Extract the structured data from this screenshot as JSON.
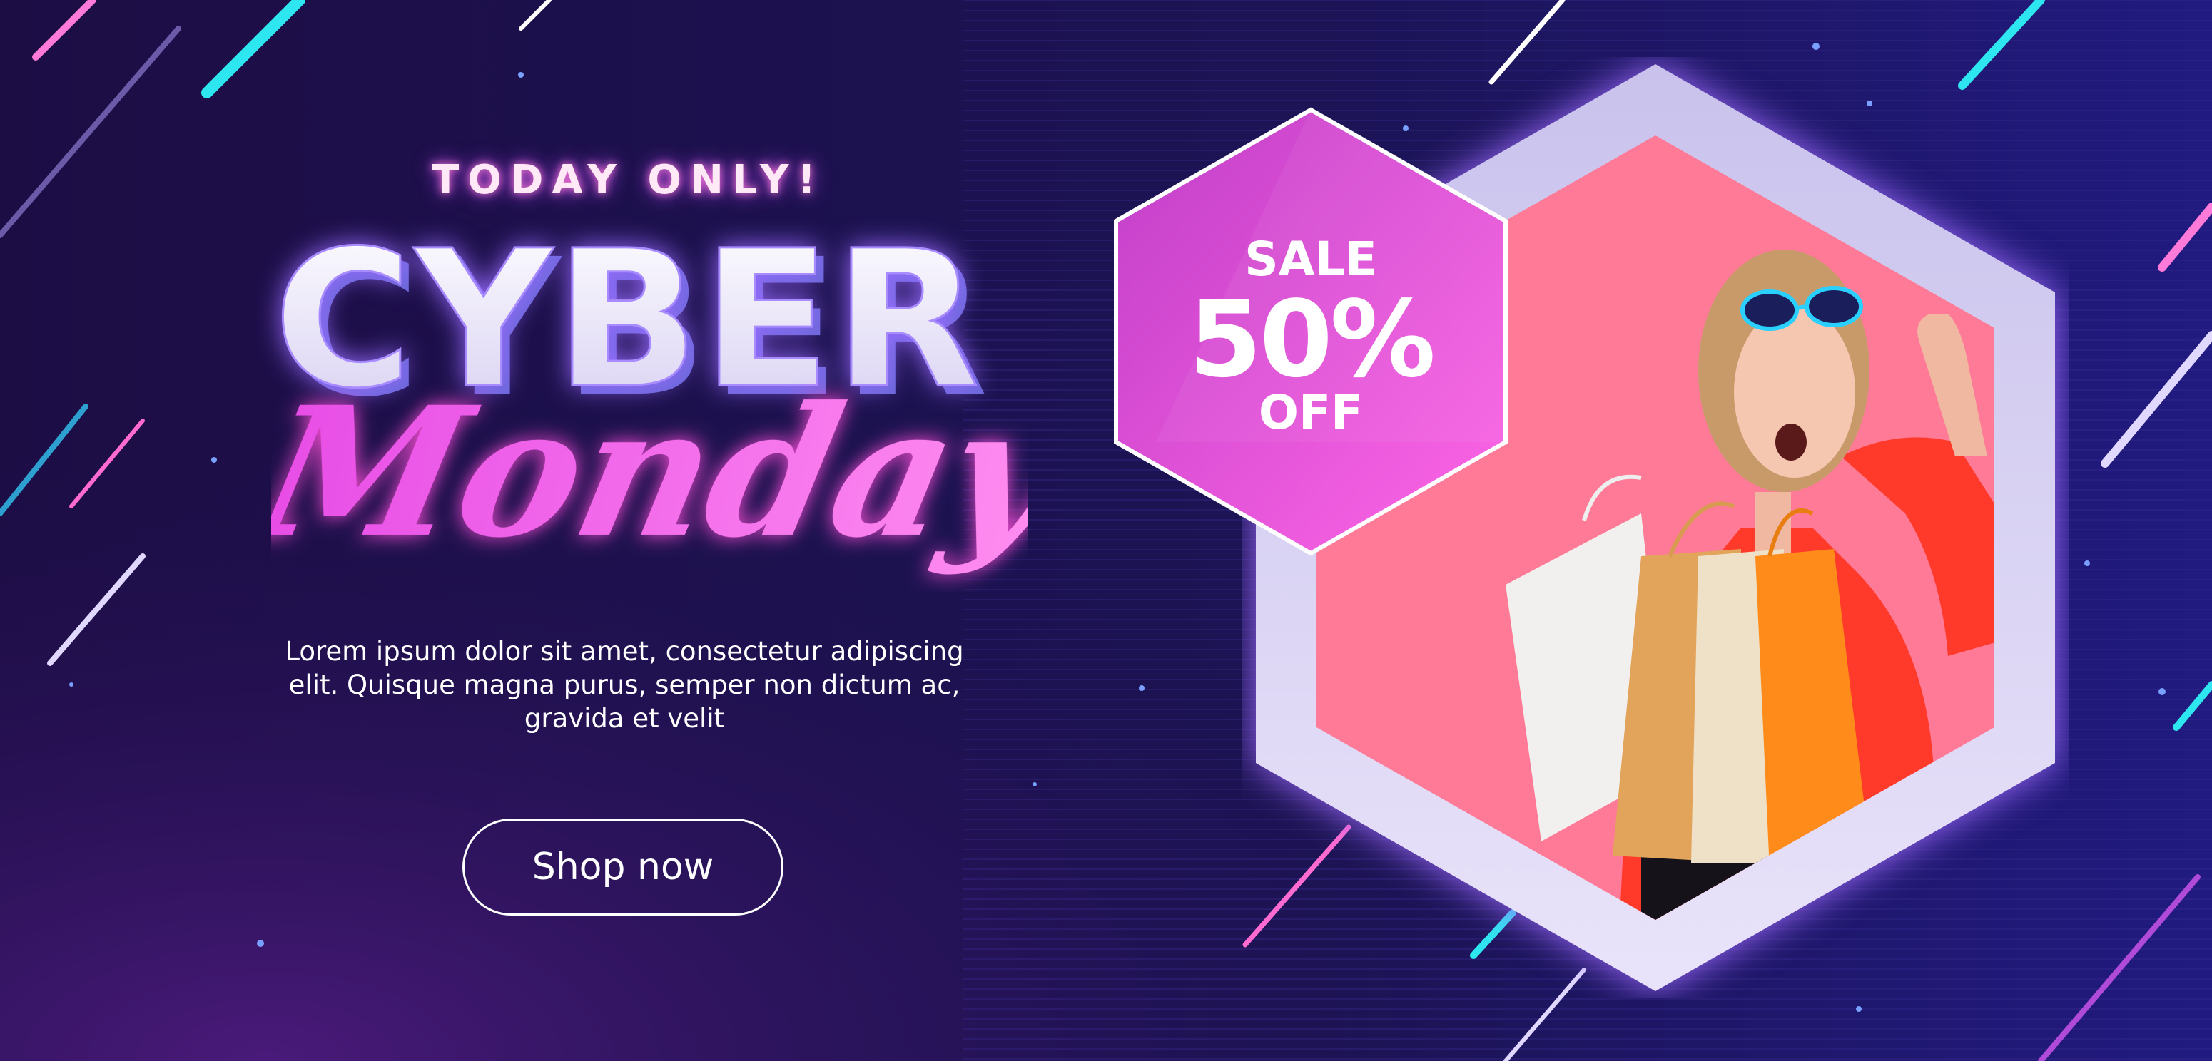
{
  "banner": {
    "kicker": "TODAY ONLY!",
    "headline": "CYBER",
    "script_headline": "Monday",
    "body": "Lorem ipsum dolor sit amet, consectetur adipiscing elit. Quisque magna purus, semper non dictum ac, gravida et velit",
    "cta_label": "Shop now"
  },
  "promo": {
    "sale_word": "SALE",
    "percent": "50%",
    "off_word": "OFF"
  },
  "photo": {
    "subject": "woman-with-shopping-bags"
  },
  "colors": {
    "background_dark": "#1a0f4a",
    "background_purple": "#3a1570",
    "neon_pink": "#ff6be0",
    "neon_cyan": "#2ee6f0",
    "hex_frame": "#d9d2f0",
    "photo_bg": "#ff7a96",
    "badge_magenta": "#d94bd8"
  }
}
